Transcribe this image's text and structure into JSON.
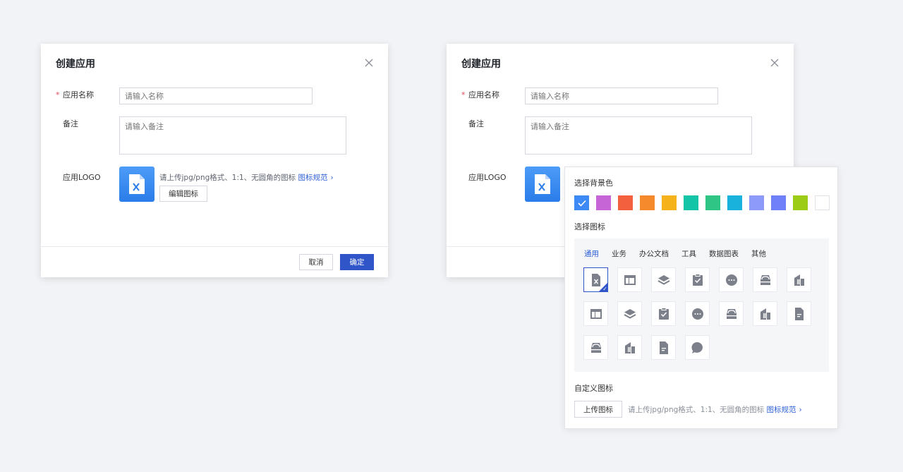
{
  "dialog": {
    "title": "创建应用",
    "required_mark": "*",
    "name_label": "应用名称",
    "name_placeholder": "请输入名称",
    "note_label": "备注",
    "note_placeholder": "请输入备注",
    "logo_label": "应用LOGO",
    "logo_hint": "请上传jpg/png格式、1:1、无圆角的图标",
    "logo_hint_link": "图标规范",
    "edit_icon_btn": "编辑图标",
    "cancel_btn": "取消",
    "ok_btn": "确定"
  },
  "picker": {
    "bg_title": "选择背景色",
    "colors": [
      "#3d8af6",
      "#c565d6",
      "#f2603e",
      "#f48a2c",
      "#f6b21b",
      "#14c4a7",
      "#2fc685",
      "#19b2dd",
      "#8e9afa",
      "#7080f8",
      "#9dcc16",
      "#ffffff"
    ],
    "selected_color_index": 0,
    "icon_title": "选择图标",
    "tabs": [
      "通用",
      "业务",
      "办公文档",
      "工具",
      "数据图表",
      "其他"
    ],
    "active_tab": 0,
    "icons": [
      "excel-icon",
      "layout-icon",
      "layers-icon",
      "clipboard-check-icon",
      "chat-more-icon",
      "inbox-icon",
      "building-icon",
      "layout-icon",
      "layers-icon",
      "clipboard-check-icon",
      "chat-more-icon",
      "inbox-icon",
      "building-icon",
      "document-icon",
      "inbox-icon",
      "building-icon",
      "document-icon",
      "chat-icon"
    ],
    "custom_title": "自定义图标",
    "upload_btn": "上传图标",
    "upload_hint": "请上传jpg/png格式、1:1、无圆角的图标",
    "upload_hint_link": "图标规范"
  }
}
